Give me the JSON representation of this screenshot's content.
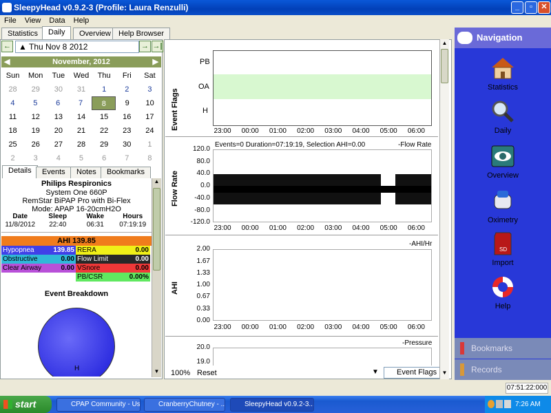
{
  "window": {
    "title": "SleepyHead v0.9.2-3  (Profile: Laura Renzulli)"
  },
  "menu": [
    "File",
    "View",
    "Data",
    "Help"
  ],
  "tabs": [
    "Statistics",
    "Daily",
    "Overview",
    "Help Browser"
  ],
  "date": {
    "value": "Thu Nov 8 2012",
    "month_label": "November,  2012"
  },
  "calendar": {
    "weekdays": [
      "Sun",
      "Mon",
      "Tue",
      "Wed",
      "Thu",
      "Fri",
      "Sat"
    ],
    "days": [
      "28",
      "29",
      "30",
      "31",
      "1",
      "2",
      "3",
      "4",
      "5",
      "6",
      "7",
      "8",
      "9",
      "10",
      "11",
      "12",
      "13",
      "14",
      "15",
      "16",
      "17",
      "18",
      "19",
      "20",
      "21",
      "22",
      "23",
      "24",
      "25",
      "26",
      "27",
      "28",
      "29",
      "30",
      "1",
      "2",
      "3",
      "4",
      "5",
      "6",
      "7",
      "8"
    ]
  },
  "subtabs": [
    "Details",
    "Events",
    "Notes",
    "Bookmarks"
  ],
  "device": {
    "brand": "Philips Respironics",
    "model": "System One 660P",
    "name": "RemStar BiPAP Pro with Bi-Flex",
    "mode": "Mode: APAP 16-20cmH2O"
  },
  "session": {
    "h_date": "Date",
    "h_sleep": "Sleep",
    "h_wake": "Wake",
    "h_hours": "Hours",
    "date": "11/8/2012",
    "sleep": "22:40",
    "wake": "06:31",
    "hours": "07:19:19"
  },
  "ahi": "AHI 139.85",
  "indices": [
    {
      "l": "Hypopnea",
      "v": "139.85",
      "r": "RERA",
      "rv": "0.00"
    },
    {
      "l": "Obstructive",
      "v": "0.00",
      "r": "Flow Limit",
      "rv": "0.00"
    },
    {
      "l": "Clear Airway",
      "v": "0.00",
      "r": "VSnore",
      "rv": "0.00"
    },
    {
      "l": "",
      "v": "",
      "r": "PB/CSR",
      "rv": "0.00%"
    }
  ],
  "breakdown": {
    "title": "Event Breakdown",
    "label": "H"
  },
  "graphs": {
    "event_flags": {
      "label": "Event Flags",
      "rows": [
        "PB",
        "OA",
        "H"
      ]
    },
    "flow": {
      "label": "Flow Rate",
      "info": "Events=0 Duration=07:19:19, Selection AHI=0.00",
      "legend": "Flow Rate",
      "ticks": [
        "120.0",
        "80.0",
        "40.0",
        "0.0",
        "-40.0",
        "-80.0",
        "-120.0"
      ]
    },
    "ahi": {
      "label": "AHI",
      "legend": "AHI/Hr",
      "ticks": [
        "2.00",
        "1.67",
        "1.33",
        "1.00",
        "0.67",
        "0.33",
        "0.00"
      ]
    },
    "pressure": {
      "legend": "Pressure",
      "ticks": [
        "20.0",
        "19.0"
      ]
    },
    "xticks": [
      "23:00",
      "00:00",
      "01:00",
      "02:00",
      "03:00",
      "04:00",
      "05:00",
      "06:00"
    ],
    "zoom": "100%",
    "reset": "Reset",
    "dropdown": "Event Flags"
  },
  "nav": {
    "title": "Navigation",
    "items": [
      "Statistics",
      "Daily",
      "Overview",
      "Oximetry",
      "Import",
      "Help"
    ],
    "bottom": [
      "Bookmarks",
      "Records"
    ]
  },
  "status": {
    "time": "07:51:22:000"
  },
  "taskbar": {
    "start": "start",
    "tasks": [
      "CPAP Community - Us...",
      "CranberryChutney - ...",
      "SleepyHead v0.9.2-3..."
    ],
    "clock": "7:26 AM"
  }
}
